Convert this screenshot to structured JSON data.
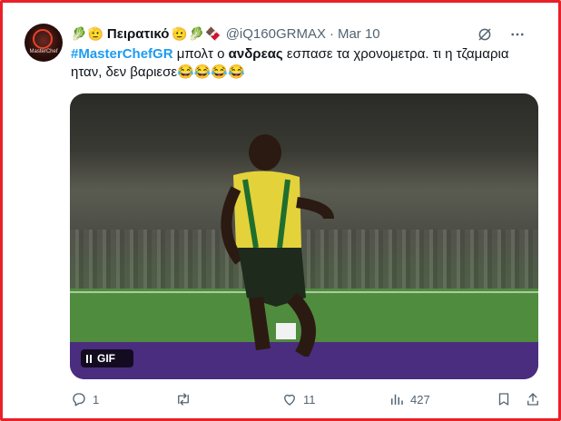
{
  "tweet": {
    "author": {
      "name": "Πειρατικό",
      "emoji_before": [
        "🥬",
        "🫡"
      ],
      "emoji_after": [
        "🫡",
        "🥬",
        "🍫"
      ],
      "handle": "@iQ160GRMAX",
      "separator": "·",
      "date": "Mar 10",
      "avatar_label": "MasterChef"
    },
    "text": {
      "hashtag": "#MasterChefGR",
      "part1": " μπολτ ο ",
      "bold_word": "ανδρεας",
      "part2": " εσπασε τα χρονομετρα. τι η τζαμαρια ηταν, δεν βαριεσε",
      "emojis": "😂😂😂😂"
    },
    "media": {
      "badge_label": "GIF",
      "icon": "pause-icon"
    },
    "actions": {
      "reply_count": "1",
      "retweet_count": "",
      "like_count": "11",
      "views_count": "427"
    },
    "colors": {
      "frame_border": "#e8202a",
      "link": "#1d9bf0",
      "text": "#0f1419",
      "muted": "#536471"
    }
  }
}
